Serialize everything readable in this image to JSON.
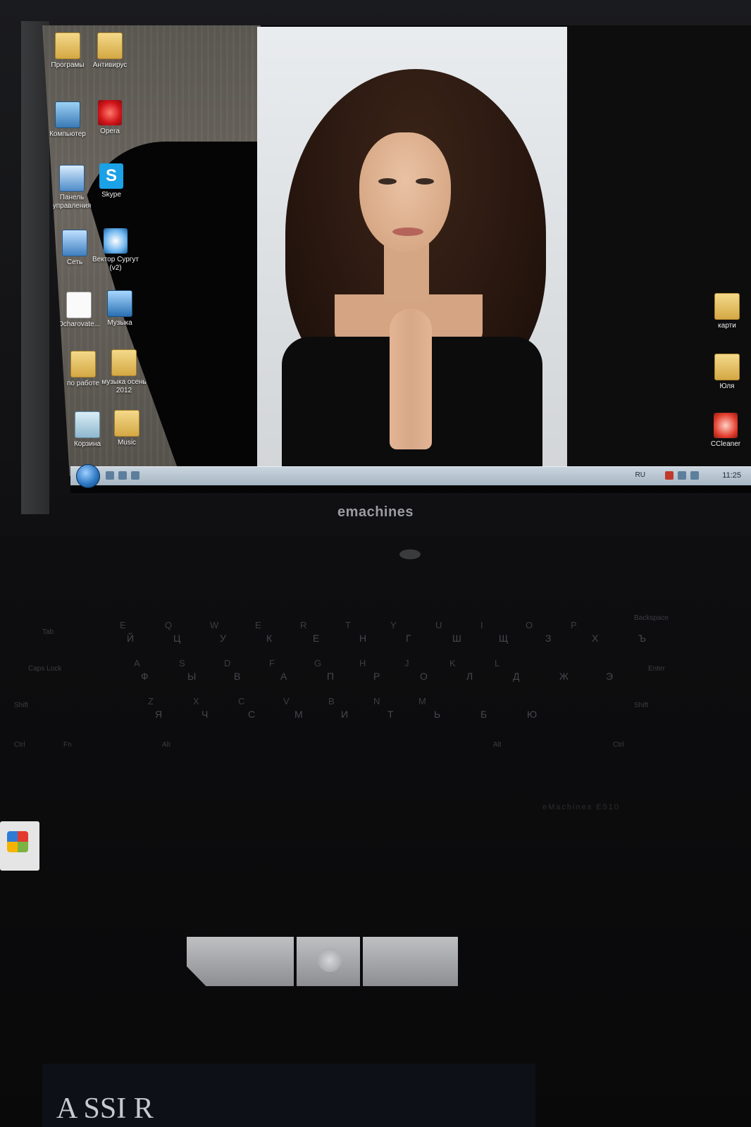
{
  "desktop": {
    "icons_left": [
      {
        "label": "Програмы",
        "icon": "folder-icon"
      },
      {
        "label": "Антивирус",
        "icon": "folder-icon"
      },
      {
        "label": "Компьютер",
        "icon": "computer-icon"
      },
      {
        "label": "Opera",
        "icon": "opera-icon"
      },
      {
        "label": "Панель управления",
        "icon": "control-panel-icon"
      },
      {
        "label": "Skype",
        "icon": "skype-icon"
      },
      {
        "label": "Сеть",
        "icon": "network-icon"
      },
      {
        "label": "Вектор Сургут (v2)",
        "icon": "shortcut-icon"
      },
      {
        "label": "Ocharovate...",
        "icon": "document-icon"
      },
      {
        "label": "Музыка",
        "icon": "music-icon"
      },
      {
        "label": "по работе",
        "icon": "folder-icon"
      },
      {
        "label": "музыка осень 2012",
        "icon": "folder-icon"
      },
      {
        "label": "Корзина",
        "icon": "recycle-bin-icon"
      },
      {
        "label": "Music",
        "icon": "folder-icon"
      }
    ],
    "icons_right": [
      {
        "label": "карти",
        "icon": "folder-icon"
      },
      {
        "label": "Юля",
        "icon": "folder-icon"
      },
      {
        "label": "CCleaner",
        "icon": "ccleaner-icon"
      }
    ]
  },
  "taskbar": {
    "language": "RU",
    "clock": "11:25"
  },
  "laptop": {
    "brand": "emachines",
    "model_text": "eMachines E510"
  },
  "keyboard": {
    "rows": [
      {
        "latin": [
          "E",
          "Q",
          "W",
          "E",
          "R",
          "T",
          "Y",
          "U",
          "I",
          "O",
          "P"
        ],
        "cyrillic": [
          "Й",
          "Ц",
          "У",
          "К",
          "Е",
          "Н",
          "Г",
          "Ш",
          "Щ",
          "З",
          "Х",
          "Ъ"
        ]
      },
      {
        "latin": [
          "A",
          "S",
          "D",
          "F",
          "G",
          "H",
          "J",
          "K",
          "L"
        ],
        "cyrillic": [
          "Ф",
          "Ы",
          "В",
          "А",
          "П",
          "Р",
          "О",
          "Л",
          "Д",
          "Ж",
          "Э"
        ]
      },
      {
        "latin": [
          "Z",
          "X",
          "C",
          "V",
          "B",
          "N",
          "M"
        ],
        "cyrillic": [
          "Я",
          "Ч",
          "С",
          "М",
          "И",
          "Т",
          "Ь",
          "Б",
          "Ю"
        ]
      }
    ],
    "mods": [
      "Tab",
      "Caps Lock",
      "Shift",
      "Ctrl",
      "Fn",
      "Alt",
      "Alt",
      "Ctrl",
      "Enter",
      "Shift",
      "Backspace"
    ]
  },
  "box": {
    "text": "A SSI R"
  }
}
